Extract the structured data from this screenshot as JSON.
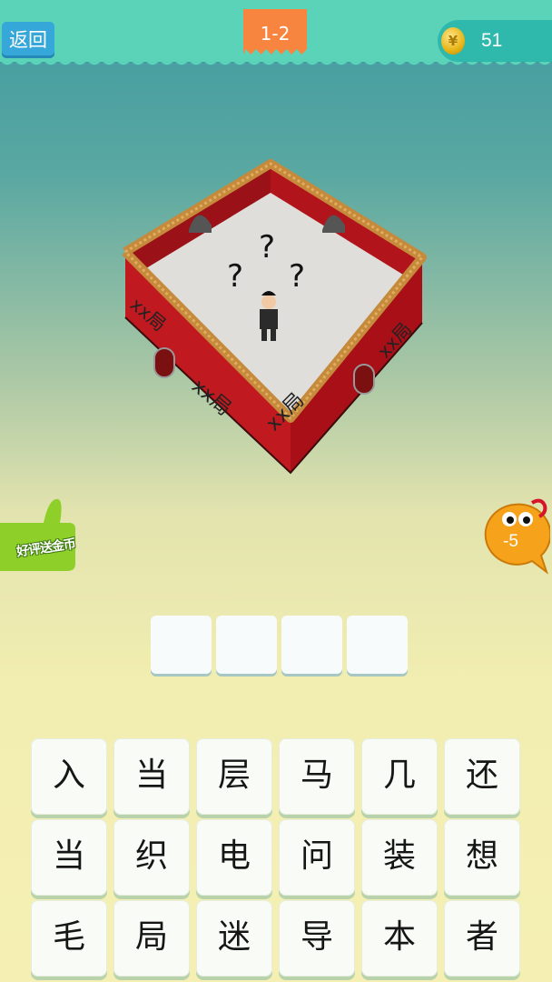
{
  "header": {
    "back_label": "返回",
    "level_label": "1-2",
    "coins": "51",
    "coin_symbol": "¥"
  },
  "puzzle": {
    "wall_text_1": "xx局",
    "wall_text_2": "xx局",
    "wall_text_3": "xx局",
    "wall_text_4": "xx局",
    "question_mark": "?"
  },
  "side": {
    "review_label": "好评送金币",
    "hint_label": "-5"
  },
  "answer": {
    "slots": [
      "",
      "",
      "",
      ""
    ]
  },
  "keyboard": {
    "keys": [
      "入",
      "当",
      "层",
      "马",
      "几",
      "还",
      "当",
      "织",
      "电",
      "问",
      "装",
      "想",
      "毛",
      "局",
      "迷",
      "导",
      "本",
      "者"
    ]
  },
  "colors": {
    "topbar": "#5ad3b9",
    "back_button": "#35a7d8",
    "level_badge": "#f8853f",
    "coin_box": "#2fb9ac",
    "wall_red": "#b2141c",
    "thumb_green": "#8fcf2a",
    "hint_orange": "#f7a21b"
  }
}
